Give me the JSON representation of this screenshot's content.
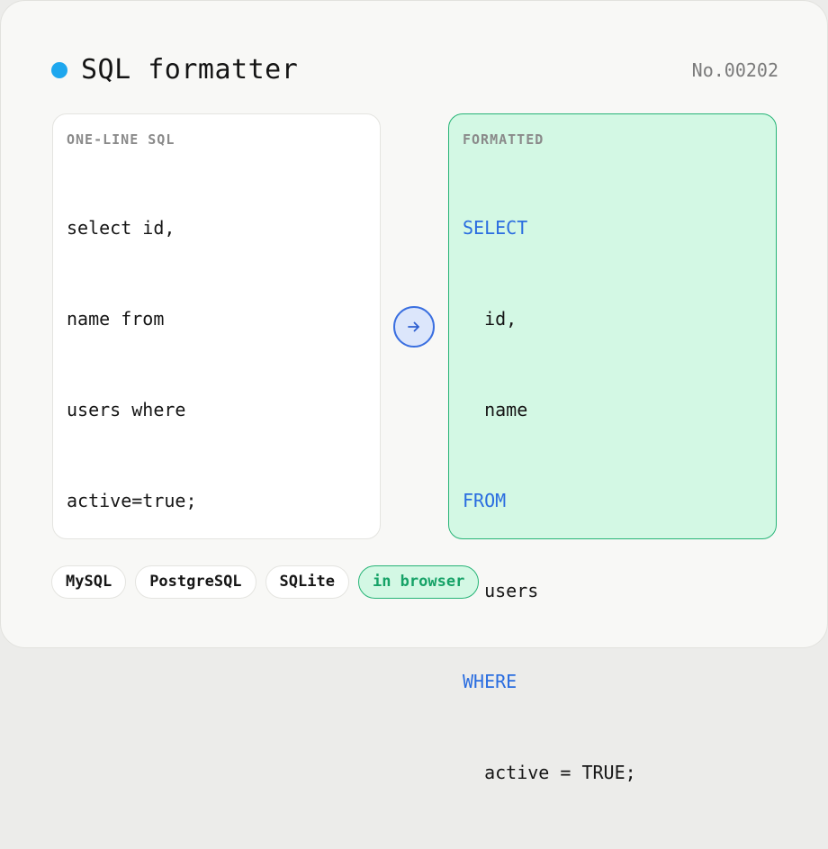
{
  "header": {
    "title": "SQL formatter",
    "serial": "No.00202",
    "dot_color": "#1ea7ee"
  },
  "input_panel": {
    "label": "ONE-LINE SQL",
    "lines": [
      "select id,",
      "name from",
      "users where",
      "active=true;"
    ]
  },
  "convert_button": {
    "icon": "arrow-right-icon"
  },
  "output_panel": {
    "label": "FORMATTED",
    "lines": [
      {
        "indent": "",
        "text": "SELECT",
        "keyword": true
      },
      {
        "indent": "  ",
        "text": "id,",
        "keyword": false
      },
      {
        "indent": "  ",
        "text": "name",
        "keyword": false
      },
      {
        "indent": "",
        "text": "FROM",
        "keyword": true
      },
      {
        "indent": "  ",
        "text": "users",
        "keyword": false
      },
      {
        "indent": "",
        "text": "WHERE",
        "keyword": true
      },
      {
        "indent": "  ",
        "text": "active = TRUE;",
        "keyword": false
      }
    ]
  },
  "chips": [
    {
      "label": "MySQL",
      "active": false
    },
    {
      "label": "PostgreSQL",
      "active": false
    },
    {
      "label": "SQLite",
      "active": false
    },
    {
      "label": "in browser",
      "active": true
    }
  ],
  "colors": {
    "accent_blue": "#2a6de0",
    "accent_green": "#27b477",
    "output_bg": "#d3f8e4"
  }
}
